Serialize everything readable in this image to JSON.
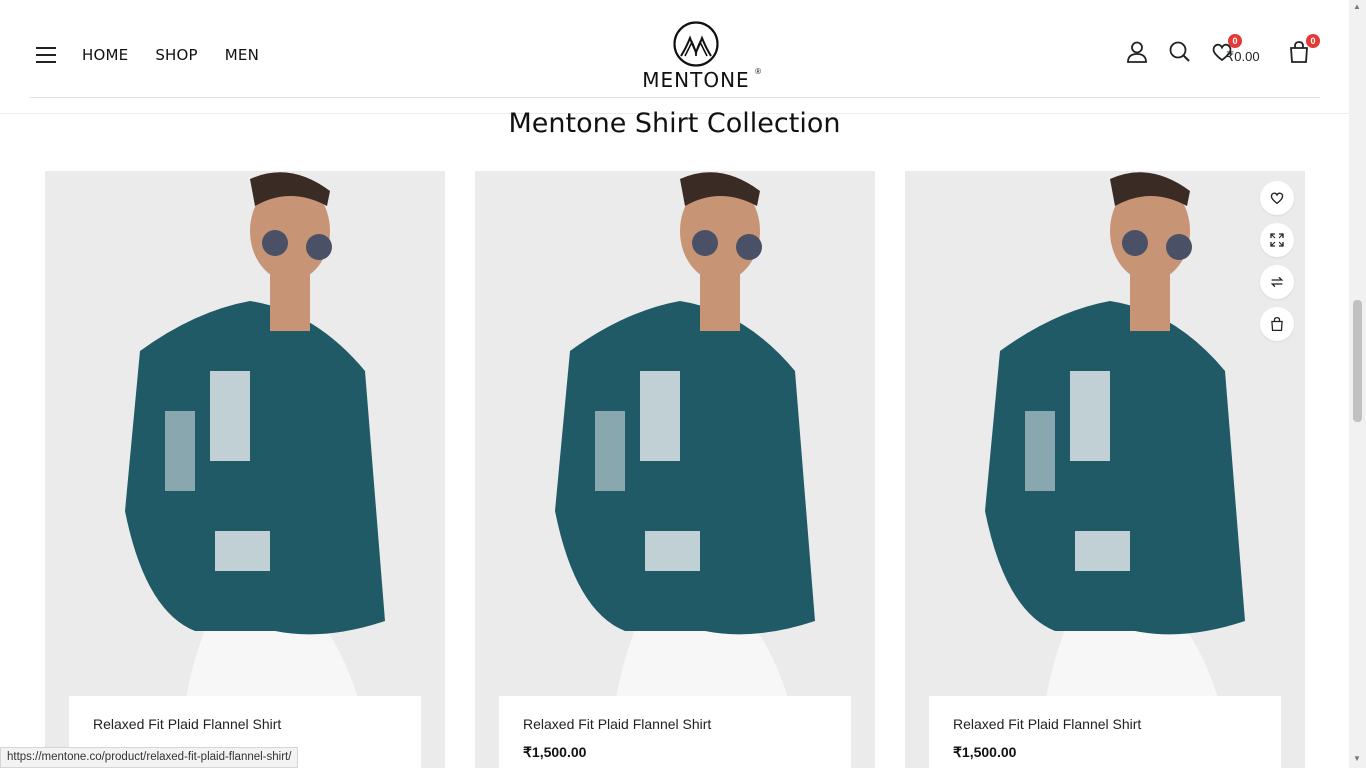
{
  "nav": {
    "menu_icon": "hamburger-icon",
    "items": [
      "HOME",
      "SHOP",
      "MEN"
    ]
  },
  "brand": {
    "name": "MENTONE",
    "registered": "®"
  },
  "header_actions": {
    "account_icon": "user-icon",
    "search_icon": "search-icon",
    "wishlist_icon": "heart-icon",
    "wishlist_count": "0",
    "cart_total": "₹0.00",
    "cart_icon": "shopping-bag-icon",
    "cart_count": "0"
  },
  "section": {
    "title": "Mentone Shirt Collection"
  },
  "products": [
    {
      "name": "Relaxed Fit Plaid Flannel Shirt",
      "price": ""
    },
    {
      "name": "Relaxed Fit Plaid Flannel Shirt",
      "price": "₹1,500.00"
    },
    {
      "name": "Relaxed Fit Plaid Flannel Shirt",
      "price": "₹1,500.00"
    }
  ],
  "product_actions": [
    "heart-icon",
    "expand-icon",
    "compare-icon",
    "shopping-bag-icon"
  ],
  "status_bar": {
    "url": "https://mentone.co/product/relaxed-fit-plaid-flannel-shirt/"
  },
  "colors": {
    "accent": "#e53935",
    "shirt": "#1f5a66",
    "background": "#ebebeb"
  }
}
